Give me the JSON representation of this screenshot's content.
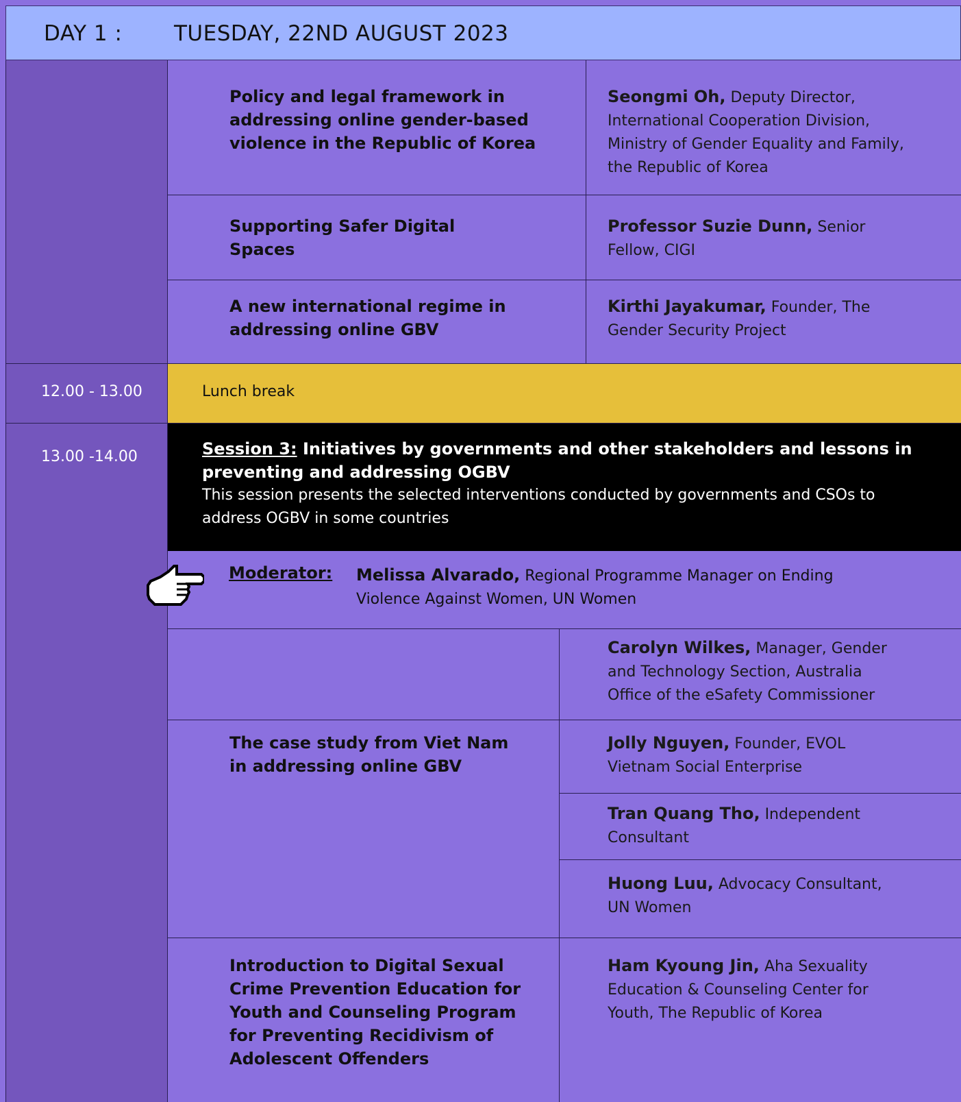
{
  "header": {
    "day": "DAY 1 :",
    "date": "TUESDAY, 22ND AUGUST 2023"
  },
  "rows_top": [
    {
      "title": "Policy and legal framework in addressing online gender-based violence in the Republic of Korea",
      "speaker_name": "Seongmi Oh,",
      "speaker_role": " Deputy Director, International Cooperation Division, Ministry of Gender Equality and Family, the Republic of Korea"
    },
    {
      "title": "Supporting Safer Digital Spaces",
      "speaker_name": "Professor Suzie Dunn,",
      "speaker_role": " Senior Fellow, CIGI"
    },
    {
      "title": "A new international regime in addressing online GBV",
      "speaker_name": "Kirthi Jayakumar,",
      "speaker_role": " Founder, The Gender Security Project"
    }
  ],
  "lunch": {
    "time": "12.00 - 13.00",
    "label": "Lunch break"
  },
  "session3": {
    "time": "13.00 -14.00",
    "label": "Session 3:",
    "title": " Initiatives by governments and other stakeholders and lessons in preventing and addressing OGBV",
    "description": "This session presents the selected interventions conducted by governments and CSOs to address OGBV in some countries"
  },
  "moderator": {
    "label": "Moderator:",
    "name": "Melissa Alvarado,",
    "role": " Regional Programme Manager on Ending Violence Against Women, UN Women"
  },
  "rows_bottom": [
    {
      "title": "",
      "speaker_name": "Carolyn Wilkes,",
      "speaker_role": " Manager, Gender and Technology Section, Australia Office of the eSafety Commissioner"
    },
    {
      "title": "The case study from Viet Nam in addressing online GBV",
      "speaker_name": "Jolly Nguyen,",
      "speaker_role": " Founder, EVOL Vietnam Social Enterprise"
    },
    {
      "title": "",
      "speaker_name": "Tran Quang Tho,",
      "speaker_role": " Independent Consultant"
    },
    {
      "title": "",
      "speaker_name": "Huong Luu,",
      "speaker_role": " Advocacy Consultant, UN Women"
    },
    {
      "title": "Introduction to Digital Sexual Crime Prevention Education for Youth and Counseling Program for Preventing Recidivism of Adolescent Offenders",
      "speaker_name": "Ham Kyoung Jin,",
      "speaker_role": " Aha Sexuality Education & Counseling Center for Youth, The Republic of Korea"
    }
  ],
  "icons": {
    "pointer": "pointing-hand-icon"
  },
  "colors": {
    "header": "#9db3ff",
    "time_column": "#7456bd",
    "content": "#8b70df",
    "lunch": "#e6bf3a",
    "session": "#000000"
  }
}
